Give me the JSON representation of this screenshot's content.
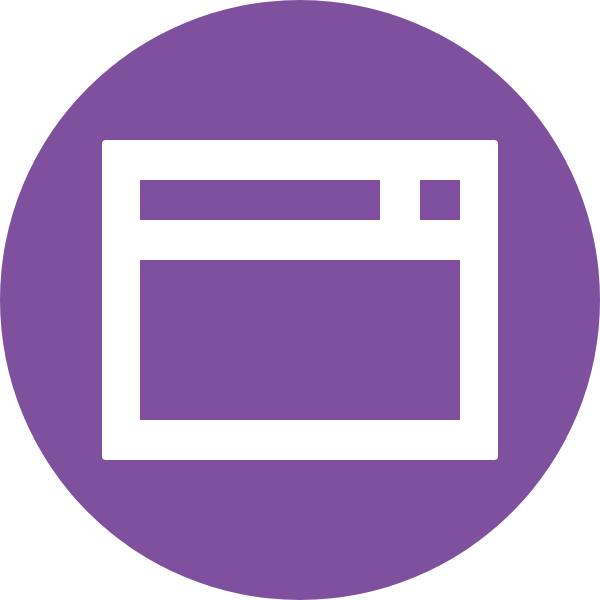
{
  "icon": {
    "name": "browser-window-icon",
    "background_color": "#7e509e",
    "glyph_color": "#ffffff",
    "shape": "circle"
  }
}
